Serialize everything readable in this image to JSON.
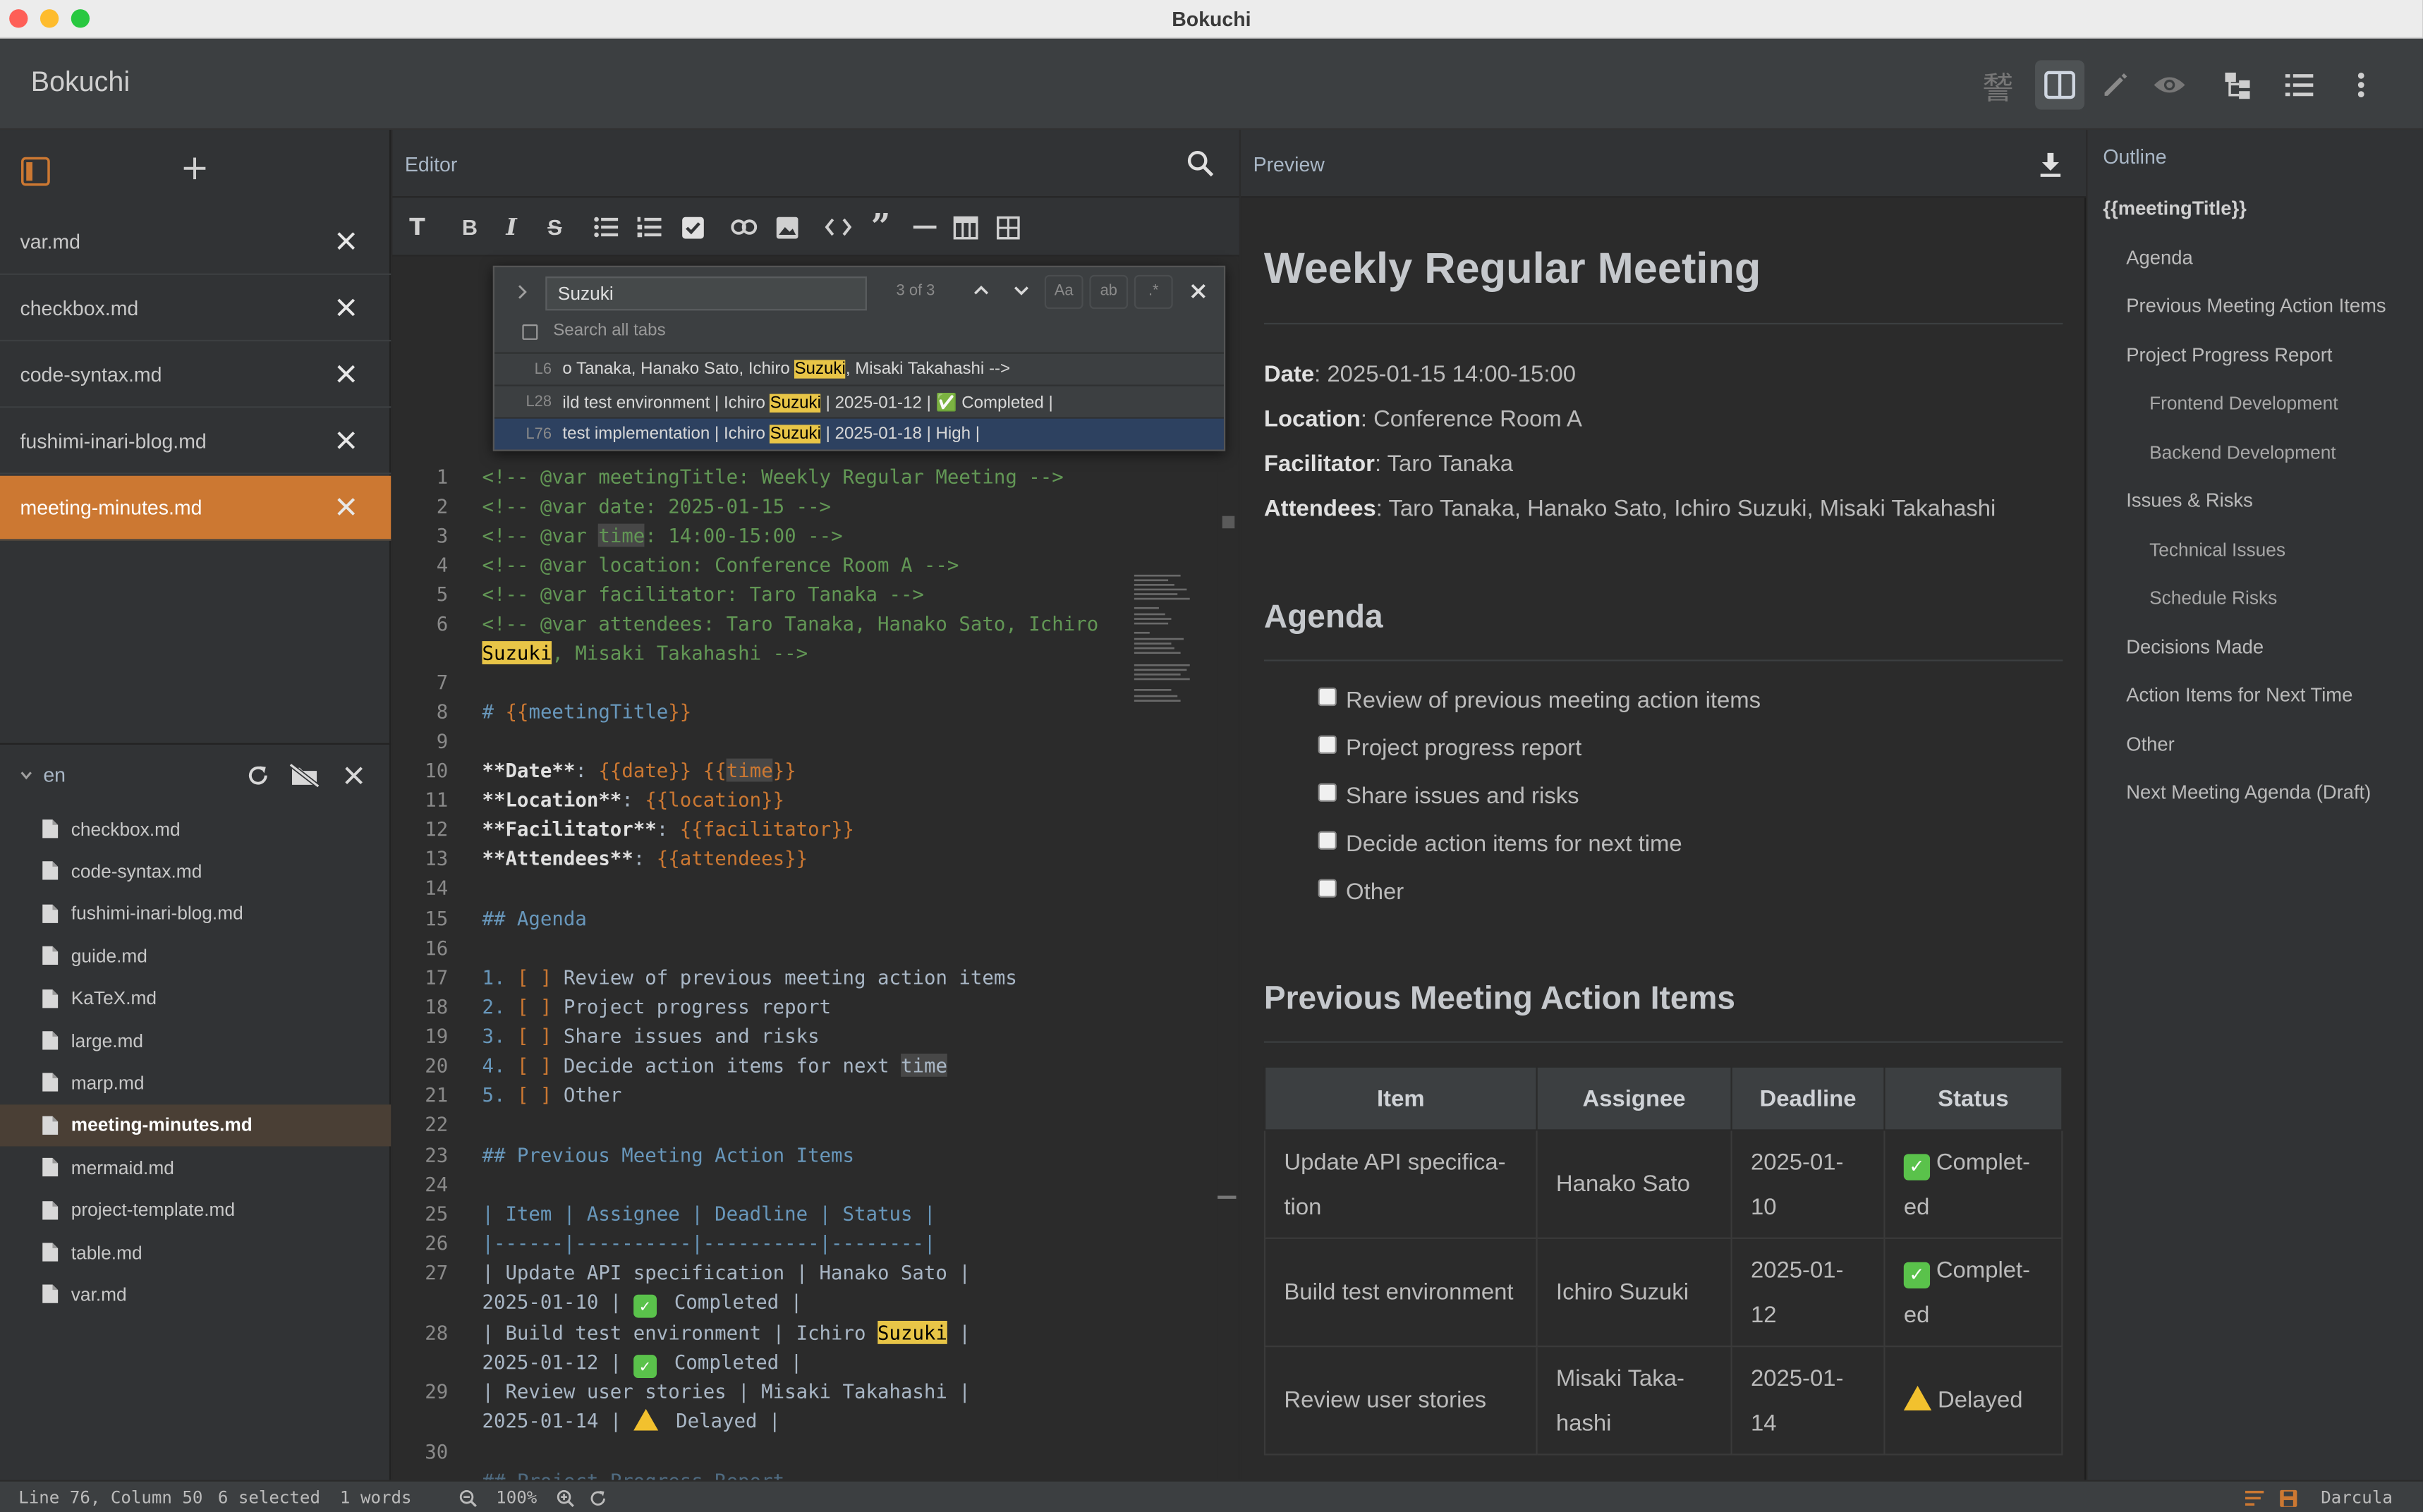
{
  "window": {
    "title": "Bokuchi"
  },
  "app": {
    "brand": "Bokuchi"
  },
  "tabs": [
    {
      "label": "var.md"
    },
    {
      "label": "checkbox.md"
    },
    {
      "label": "code-syntax.md"
    },
    {
      "label": "fushimi-inari-blog.md"
    },
    {
      "label": "meeting-minutes.md",
      "active": true
    }
  ],
  "explorer": {
    "folder": "en",
    "files": [
      "checkbox.md",
      "code-syntax.md",
      "fushimi-inari-blog.md",
      "guide.md",
      "KaTeX.md",
      "large.md",
      "marp.md",
      "meeting-minutes.md",
      "mermaid.md",
      "project-template.md",
      "table.md",
      "var.md"
    ],
    "active_file": "meeting-minutes.md"
  },
  "editor": {
    "label": "Editor",
    "find": {
      "query": "Suzuki",
      "count": "3 of 3",
      "search_all_tabs": "Search all tabs",
      "opt_case": "Aa",
      "opt_word": "ab",
      "opt_regex": ".*",
      "results": [
        {
          "line": "L6",
          "pre": "o Tanaka, Hanako Sato, Ichiro ",
          "match": "Suzuki",
          "post": ", Misaki Takahashi -->"
        },
        {
          "line": "L28",
          "pre": "ild test environment | Ichiro ",
          "match": "Suzuki",
          "post": " | 2025-01-12 | ✅ Completed |"
        },
        {
          "line": "L76",
          "pre": "test implementation | Ichiro ",
          "match": "Suzuki",
          "post": " | 2025-01-18 | High |"
        }
      ]
    }
  },
  "preview": {
    "label": "Preview",
    "title": "Weekly Regular Meeting",
    "meta": [
      {
        "key": "Date",
        "value": ": 2025-01-15 14:00-15:00"
      },
      {
        "key": "Location",
        "value": ": Conference Room A"
      },
      {
        "key": "Facilitator",
        "value": ": Taro Tanaka"
      },
      {
        "key": "Attendees",
        "value": ": Taro Tanaka, Hanako Sato, Ichiro Suzuki, Misaki Takahashi"
      }
    ],
    "agenda_heading": "Agenda",
    "agenda": [
      "Review of previous meeting action items",
      "Project progress report",
      "Share issues and risks",
      "Decide action items for next time",
      "Other"
    ],
    "actions_heading": "Previous Meeting Action Items",
    "table": {
      "headers": [
        "Item",
        "Assignee",
        "Deadline",
        "Status"
      ],
      "rows": [
        {
          "item_a": "Update API specifica-",
          "item_b": "tion",
          "assignee_a": "Hanako Sato",
          "assignee_b": "",
          "deadline_a": "2025-01-",
          "deadline_b": "10",
          "status_a": "Complet-",
          "status_b": "ed",
          "status_icon": "✅"
        },
        {
          "item_a": "Build test environment",
          "item_b": "",
          "assignee_a": "Ichiro Suzuki",
          "assignee_b": "",
          "deadline_a": "2025-01-",
          "deadline_b": "12",
          "status_a": "Complet-",
          "status_b": "ed",
          "status_icon": "✅"
        },
        {
          "item_a": "Review user stories",
          "item_b": "",
          "assignee_a": "Misaki Taka-",
          "assignee_b": "hashi",
          "deadline_a": "2025-01-",
          "deadline_b": "14",
          "status_a": "Delayed",
          "status_b": "",
          "status_icon": "⚠️"
        }
      ]
    }
  },
  "outline": {
    "label": "Outline",
    "items": [
      {
        "text": "{{meetingTitle}}",
        "level": 1
      },
      {
        "text": "Agenda",
        "level": 2
      },
      {
        "text": "Previous Meeting Action Items",
        "level": 2
      },
      {
        "text": "Project Progress Report",
        "level": 2
      },
      {
        "text": "Frontend Development",
        "level": 3
      },
      {
        "text": "Backend Development",
        "level": 3
      },
      {
        "text": "Issues & Risks",
        "level": 2
      },
      {
        "text": "Technical Issues",
        "level": 3
      },
      {
        "text": "Schedule Risks",
        "level": 3
      },
      {
        "text": "Decisions Made",
        "level": 2
      },
      {
        "text": "Action Items for Next Time",
        "level": 2
      },
      {
        "text": "Other",
        "level": 2
      },
      {
        "text": "Next Meeting Agenda (Draft)",
        "level": 2
      }
    ]
  },
  "status": {
    "position": "Line 76, Column 50",
    "selected": "6 selected",
    "words": "1 words",
    "zoom": "100%",
    "theme": "Darcula"
  },
  "colors": {
    "accent": "#cc7832",
    "background": "#2b2b2b",
    "panel": "#3c3f41",
    "highlight": "#e8c547"
  }
}
